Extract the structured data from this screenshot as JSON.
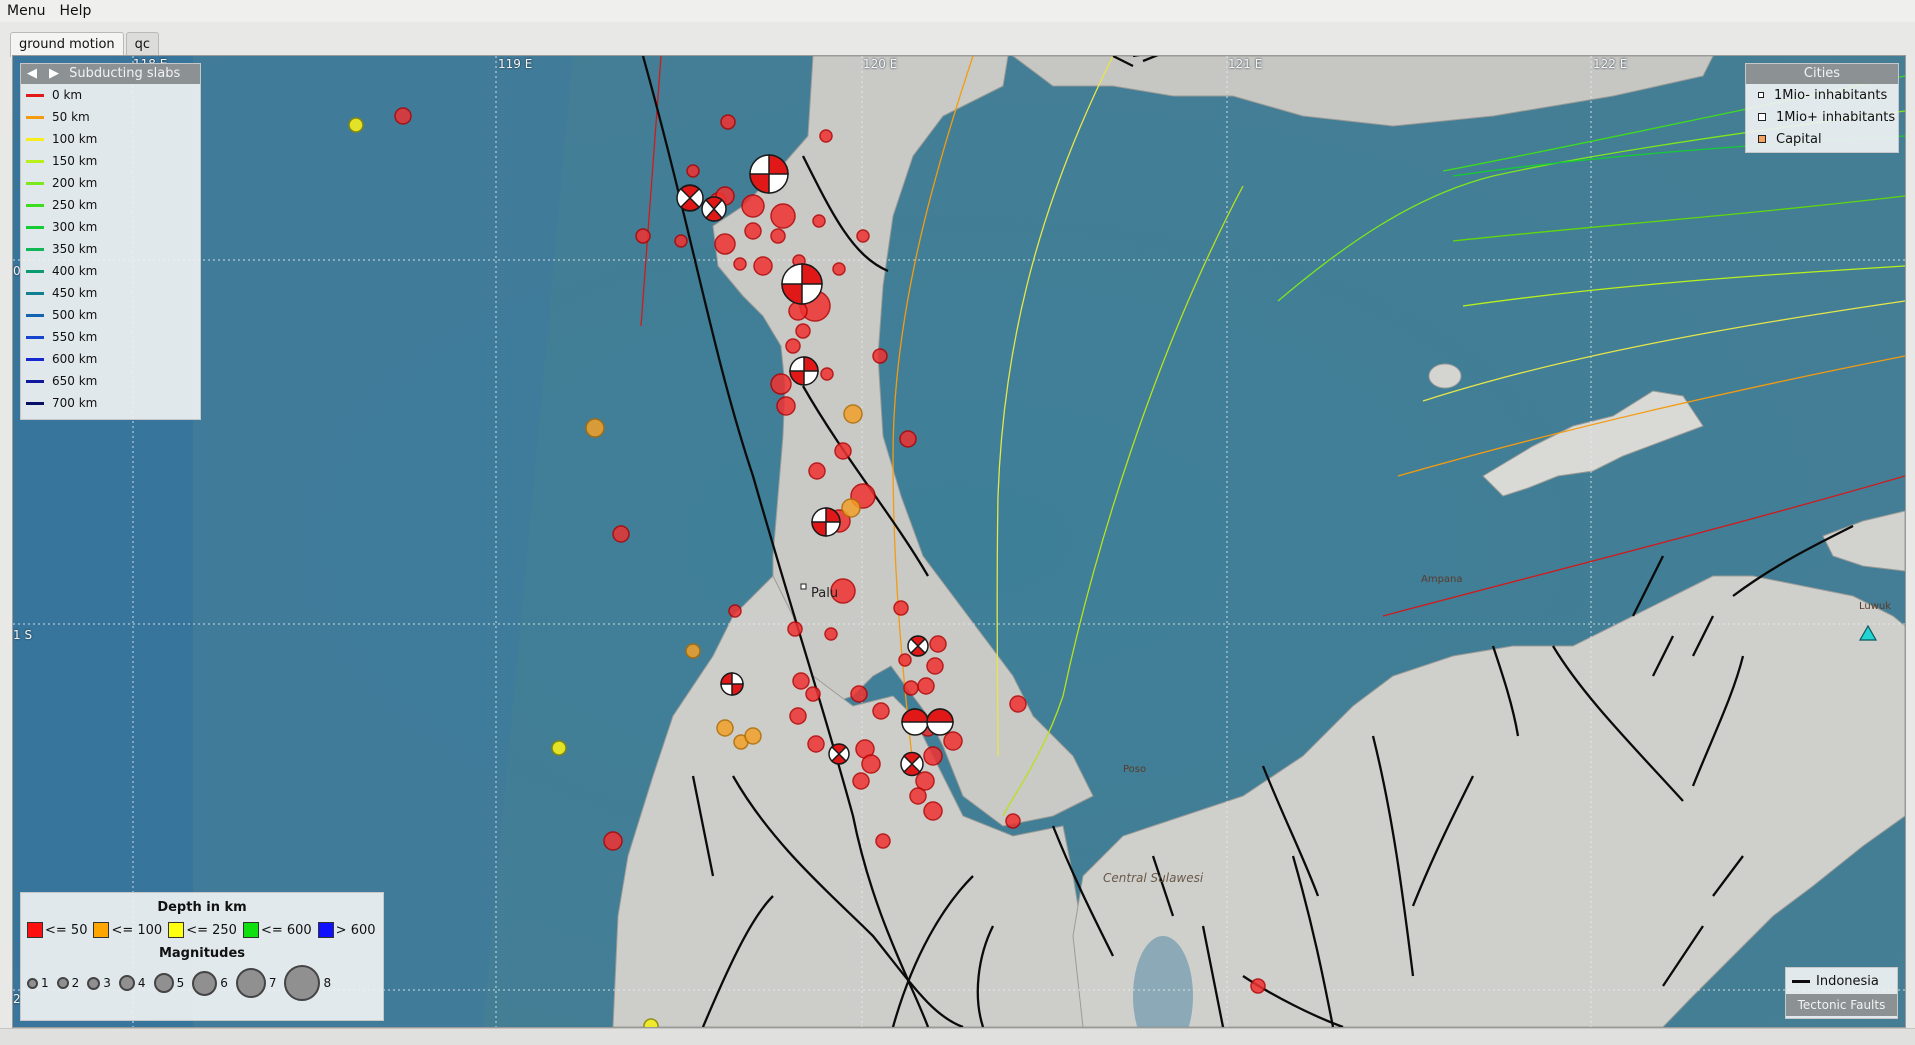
{
  "menu": {
    "items": [
      "Menu",
      "Help"
    ]
  },
  "tabs": [
    {
      "label": "ground motion",
      "active": true
    },
    {
      "label": "qc",
      "active": false
    }
  ],
  "map": {
    "lon_labels": [
      "118 E",
      "119 E",
      "120 E",
      "121 E",
      "122 E"
    ],
    "lat_labels": [
      "0",
      "1 S",
      "2"
    ],
    "place_labels": [
      "Palu",
      "Ampana",
      "Poso",
      "Central Sulawesi",
      "Luwuk"
    ]
  },
  "slabs_legend": {
    "title": "Subducting slabs",
    "items": [
      {
        "label": "0 km",
        "color": "#e01919"
      },
      {
        "label": "50 km",
        "color": "#f39c12"
      },
      {
        "label": "100 km",
        "color": "#f5ee1c"
      },
      {
        "label": "150 km",
        "color": "#b9f01c"
      },
      {
        "label": "200 km",
        "color": "#7de81c"
      },
      {
        "label": "250 km",
        "color": "#3edc1f"
      },
      {
        "label": "300 km",
        "color": "#16cc34"
      },
      {
        "label": "350 km",
        "color": "#10b655"
      },
      {
        "label": "400 km",
        "color": "#0c9a72"
      },
      {
        "label": "450 km",
        "color": "#107f8f"
      },
      {
        "label": "500 km",
        "color": "#1463b0"
      },
      {
        "label": "550 km",
        "color": "#1644cc"
      },
      {
        "label": "600 km",
        "color": "#1528cf"
      },
      {
        "label": "650 km",
        "color": "#10189c"
      },
      {
        "label": "700 km",
        "color": "#0a0f66"
      }
    ]
  },
  "cities_legend": {
    "title": "Cities",
    "items": [
      {
        "label": "1Mio- inhabitants",
        "color": "#ffffff"
      },
      {
        "label": "1Mio+ inhabitants",
        "color": "#ffffff"
      },
      {
        "label": "Capital",
        "color": "#f4a460"
      }
    ]
  },
  "depth_legend": {
    "title": "Depth in km",
    "items": [
      {
        "label": "<= 50",
        "color": "#ff1010"
      },
      {
        "label": "<= 100",
        "color": "#ffa500"
      },
      {
        "label": "<= 250",
        "color": "#ffff10"
      },
      {
        "label": "<= 600",
        "color": "#10e010"
      },
      {
        "label": "> 600",
        "color": "#1010ff"
      }
    ],
    "magnitudes_title": "Magnitudes",
    "magnitudes": [
      "1",
      "2",
      "3",
      "4",
      "5",
      "6",
      "7",
      "8"
    ]
  },
  "faults_legend": {
    "item": "Indonesia",
    "title": "Tectonic Faults"
  }
}
